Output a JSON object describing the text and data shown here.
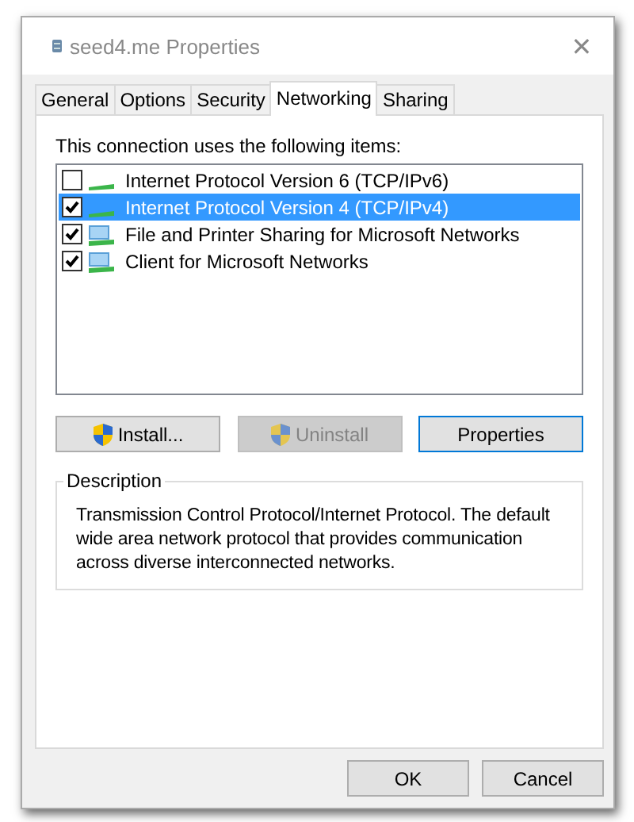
{
  "window": {
    "title": "seed4.me Properties",
    "close": "✕"
  },
  "tabs": [
    {
      "label": "General",
      "selected": false
    },
    {
      "label": "Options",
      "selected": false
    },
    {
      "label": "Security",
      "selected": false
    },
    {
      "label": "Networking",
      "selected": true
    },
    {
      "label": "Sharing",
      "selected": false
    }
  ],
  "items_label": "This connection uses the following items:",
  "items": [
    {
      "label": "Internet Protocol Version 6 (TCP/IPv6)",
      "checked": false,
      "selected": false,
      "kind": "protocol"
    },
    {
      "label": "Internet Protocol Version 4 (TCP/IPv4)",
      "checked": true,
      "selected": true,
      "kind": "protocol"
    },
    {
      "label": "File and Printer Sharing for Microsoft Networks",
      "checked": true,
      "selected": false,
      "kind": "service"
    },
    {
      "label": "Client for Microsoft Networks",
      "checked": true,
      "selected": false,
      "kind": "service"
    }
  ],
  "item_buttons": [
    {
      "label": "Install...",
      "shield": true,
      "disabled": false,
      "focused": false
    },
    {
      "label": "Uninstall",
      "shield": true,
      "disabled": true,
      "focused": false
    },
    {
      "label": "Properties",
      "shield": false,
      "disabled": false,
      "focused": true
    }
  ],
  "description": {
    "title": "Description",
    "text": "Transmission Control Protocol/Internet Protocol. The default wide area network protocol that provides communication across diverse interconnected networks."
  },
  "buttons": [
    "OK",
    "Cancel"
  ]
}
